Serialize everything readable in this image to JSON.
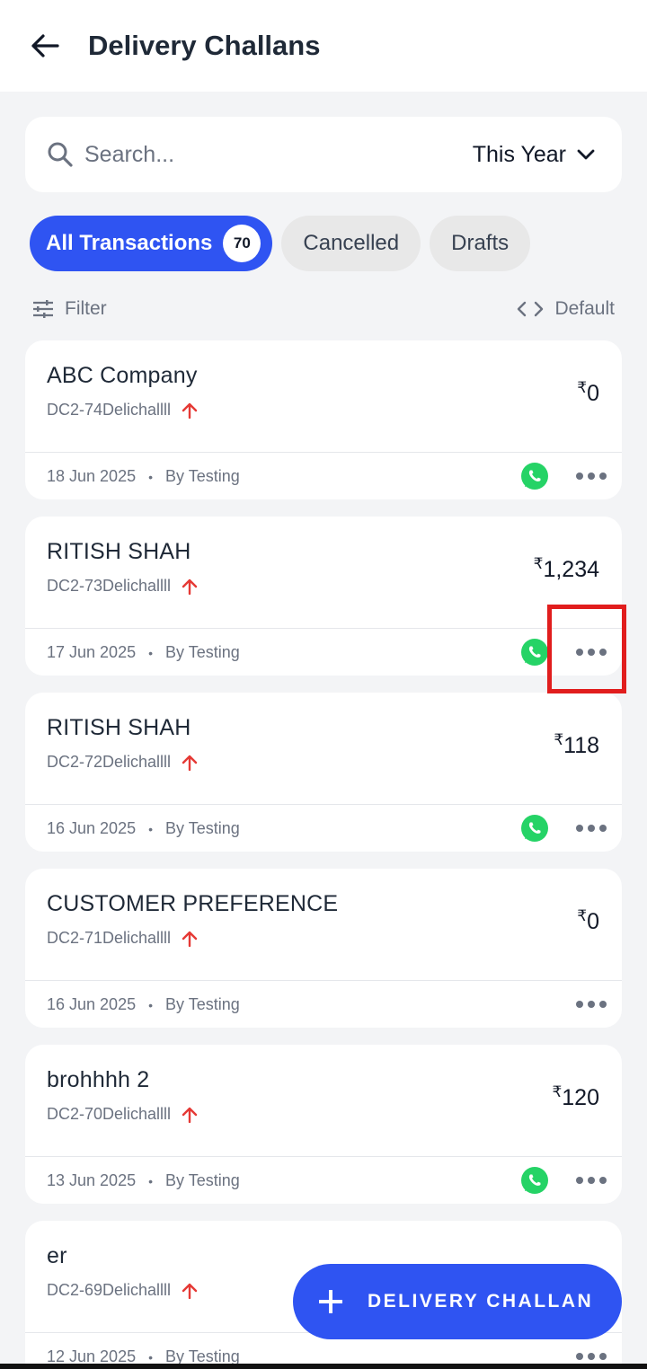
{
  "header": {
    "title": "Delivery Challans"
  },
  "search": {
    "placeholder": "Search...",
    "period": "This Year"
  },
  "tabs": [
    {
      "label": "All Transactions",
      "count": "70"
    },
    {
      "label": "Cancelled"
    },
    {
      "label": "Drafts"
    }
  ],
  "filter": {
    "label": "Filter",
    "sort_label": "Default"
  },
  "transactions": [
    {
      "name": "ABC Company",
      "ref": "DC2-74Delichallll",
      "amount": "0",
      "date": "18 Jun 2025",
      "by": "By Testing"
    },
    {
      "name": "RITISH SHAH",
      "ref": "DC2-73Delichallll",
      "amount": "1,234",
      "date": "17 Jun 2025",
      "by": "By Testing"
    },
    {
      "name": "RITISH SHAH",
      "ref": "DC2-72Delichallll",
      "amount": "118",
      "date": "16 Jun 2025",
      "by": "By Testing"
    },
    {
      "name": "CUSTOMER PREFERENCE",
      "ref": "DC2-71Delichallll",
      "amount": "0",
      "date": "16 Jun 2025",
      "by": "By Testing"
    },
    {
      "name": "brohhhh 2",
      "ref": "DC2-70Delichallll",
      "amount": "120",
      "date": "13 Jun 2025",
      "by": "By Testing"
    },
    {
      "name": "er",
      "ref": "DC2-69Delichallll",
      "amount": "",
      "date": "12 Jun 2025",
      "by": "By Testing"
    }
  ],
  "currency_symbol": "₹",
  "separator": "•",
  "fab": {
    "label": "DELIVERY CHALLAN",
    "icon": "plus-icon"
  },
  "colors": {
    "primary": "#2f54f2",
    "whatsapp": "#25d366",
    "up_arrow": "#e53935",
    "highlight": "#e11d1d"
  },
  "icons": [
    "back-arrow-icon",
    "search-icon",
    "chevron-down-icon",
    "filter-sliders-icon",
    "code-brackets-icon",
    "up-arrow-icon",
    "whatsapp-icon",
    "more-dots-icon",
    "plus-icon"
  ]
}
